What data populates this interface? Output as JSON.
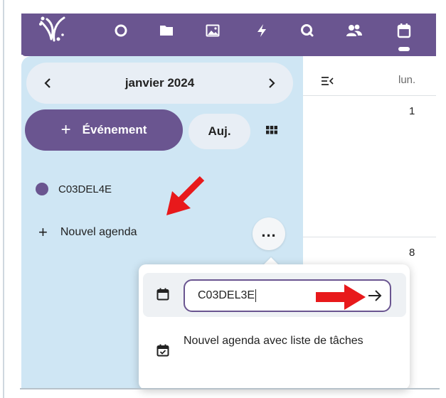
{
  "top_nav": {
    "icons": [
      "app-logo",
      "dashboard-icon",
      "files-icon",
      "photos-icon",
      "activity-icon",
      "search-icon",
      "contacts-icon",
      "calendar-icon"
    ],
    "active": "calendar-icon"
  },
  "sidebar": {
    "month_label": "janvier 2024",
    "new_event_label": "Événement",
    "today_label": "Auj.",
    "calendars": [
      {
        "name": "C03DEL4E",
        "color": "#6a5590"
      }
    ],
    "new_calendar_label": "Nouvel agenda"
  },
  "calendar": {
    "day_header": "lun.",
    "day_numbers": [
      "1",
      "8"
    ]
  },
  "popover": {
    "input_value": "C03DEL3E",
    "task_calendar_label": "Nouvel agenda avec liste de tâches"
  },
  "colors": {
    "accent": "#6a5590",
    "sidebar_bg": "#cfe6f4",
    "annotation": "#e8191b"
  }
}
